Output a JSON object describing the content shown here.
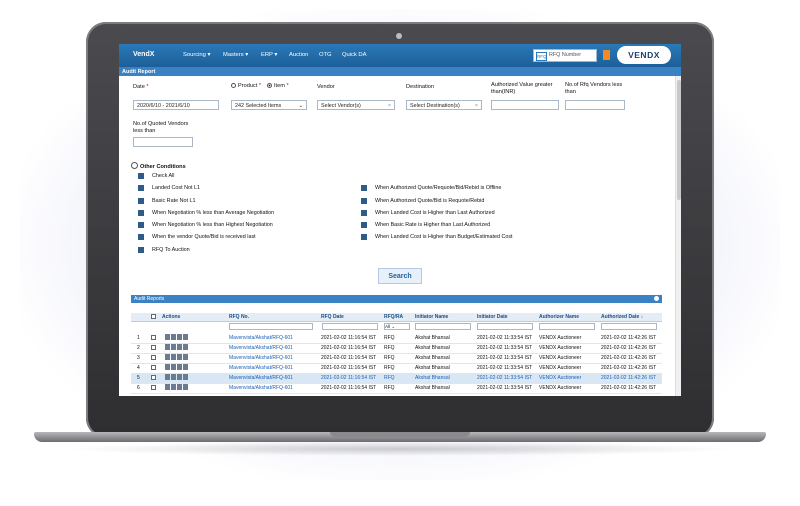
{
  "nav": {
    "brand": "VendX",
    "menu": [
      "Sourcing ▾",
      "Masters ▾",
      "ERP ▾",
      "Auction",
      "OTG",
      "Quick DA"
    ],
    "rfq_placeholder": "RFQ Number",
    "rfq_icon_text": "RFQ",
    "logo": "VENDX"
  },
  "strip_title": "Audit Report",
  "form": {
    "date_label": "Date",
    "date_value": "2020/6/10 - 2021/6/10",
    "product_label": "Product",
    "item_label": "Item",
    "item_value": "242 Selected Items",
    "vendor_label": "Vendor",
    "vendor_value": "Select Vendor(s)",
    "destination_label": "Destination",
    "destination_value": "Select Destination(s)",
    "authorized_value_label": "Authorized Value greater than(INR)",
    "rfq_vendors_label": "No.of Rfq Vendors less than",
    "quoted_vendors_label": "No.of Quoted Vendors less than",
    "req_mark": "*"
  },
  "conditions": {
    "title": "Other Conditions",
    "left": [
      "Check All",
      "Landed Cost Not L1",
      "Basic Rate Not L1",
      "When Negotiation % less than Average Negotiation",
      "When Negotiation % less than Highest Negotiation",
      "When the vendor Quote/Bid is received last",
      "RFQ To Auction"
    ],
    "right": [
      "When Authorized Quote/Requote/Bid/Rebid is Offline",
      "When Authorized Quote/Bid is Requote/Rebid",
      "When Landed Cost is Higher than Last Authorized",
      "When Basic Rate is Higher than Last Authorized",
      "When Landed Cost is Higher than Budget/Estimated Cost"
    ]
  },
  "search_label": "Search",
  "grid": {
    "title": "Audit Reports",
    "columns": [
      "Actions",
      "RFQ No.",
      "RFQ Date",
      "RFQ/RA",
      "Initiator Name",
      "Initiator Date",
      "Authorizer Name",
      "Authorized Date ↓"
    ],
    "rfqra_filter": "All",
    "rows": [
      {
        "n": "1",
        "rfq": "Mavenvista/Akshat/RFQ-601",
        "date": "2021-02-02 11:16:54 IST",
        "type": "RFQ",
        "initiator": "Akshat Bhansal",
        "idate": "2021-02-02 11:33:54 IST",
        "authorizer": "VENDX Auctioneer",
        "adate": "2021-02-02 11:42:26 IST"
      },
      {
        "n": "2",
        "rfq": "Mavenvista/Akshat/RFQ-601",
        "date": "2021-02-02 11:16:54 IST",
        "type": "RFQ",
        "initiator": "Akshat Bhansal",
        "idate": "2021-02-02 11:33:54 IST",
        "authorizer": "VENDX Auctioneer",
        "adate": "2021-02-02 11:42:26 IST"
      },
      {
        "n": "3",
        "rfq": "Mavenvista/Akshat/RFQ-601",
        "date": "2021-02-02 11:16:54 IST",
        "type": "RFQ",
        "initiator": "Akshat Bhansal",
        "idate": "2021-02-02 11:33:54 IST",
        "authorizer": "VENDX Auctioneer",
        "adate": "2021-02-02 11:42:26 IST"
      },
      {
        "n": "4",
        "rfq": "Mavenvista/Akshat/RFQ-601",
        "date": "2021-02-02 11:16:54 IST",
        "type": "RFQ",
        "initiator": "Akshat Bhansal",
        "idate": "2021-02-02 11:33:54 IST",
        "authorizer": "VENDX Auctioneer",
        "adate": "2021-02-02 11:42:26 IST"
      },
      {
        "n": "5",
        "rfq": "Mavenvista/Akshat/RFQ-601",
        "date": "2021-02-02 11:16:54 IST",
        "type": "RFQ",
        "initiator": "Akshat Bhansal",
        "idate": "2021-02-02 11:33:54 IST",
        "authorizer": "VENDX Auctioneer",
        "adate": "2021-02-02 11:42:26 IST"
      },
      {
        "n": "6",
        "rfq": "Mavenvista/Akshat/RFQ-601",
        "date": "2021-02-02 11:16:54 IST",
        "type": "RFQ",
        "initiator": "Akshat Bhansal",
        "idate": "2021-02-02 11:33:54 IST",
        "authorizer": "VENDX Auctioneer",
        "adate": "2021-02-02 11:42:26 IST"
      }
    ]
  },
  "colors": {
    "nav": "#1d5f98",
    "accent": "#3b82c4",
    "checkbox": "#2f5b86",
    "logo_orange": "#f08a24"
  }
}
